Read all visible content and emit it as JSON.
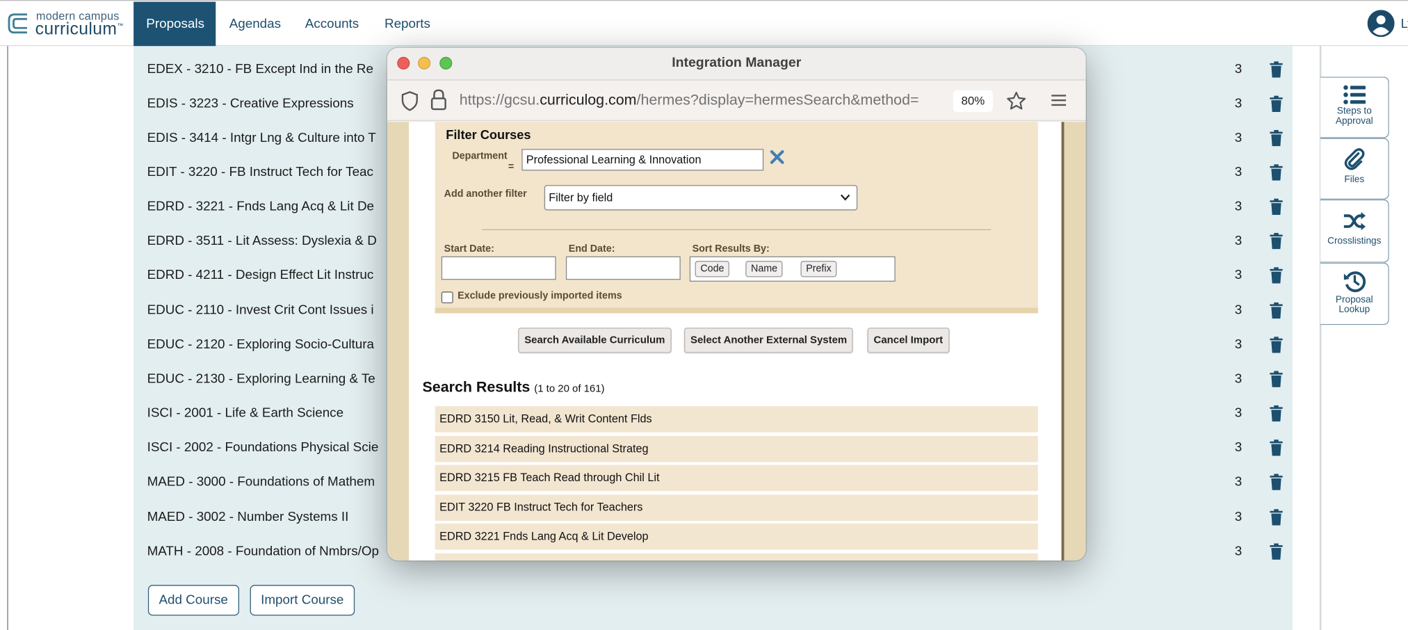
{
  "brand": {
    "small": "modern campus",
    "big": "curriculum",
    "tm": "™"
  },
  "nav": [
    "Proposals",
    "Agendas",
    "Accounts",
    "Reports"
  ],
  "user": {
    "initials": "Ly"
  },
  "courses": [
    {
      "title": "EDEX - 3210 - FB Except Ind in the Re",
      "credits": "3"
    },
    {
      "title": "EDIS - 3223 - Creative Expressions",
      "credits": "3"
    },
    {
      "title": "EDIS - 3414 - Intgr Lng & Culture into T",
      "credits": "3"
    },
    {
      "title": "EDIT - 3220 - FB Instruct Tech for Teac",
      "credits": "3"
    },
    {
      "title": "EDRD - 3221 - Fnds Lang Acq & Lit De",
      "credits": "3"
    },
    {
      "title": "EDRD - 3511 - Lit Assess: Dyslexia & D",
      "credits": "3"
    },
    {
      "title": "EDRD - 4211 - Design Effect Lit Instruc",
      "credits": "3"
    },
    {
      "title": "EDUC - 2110 - Invest Crit Cont Issues i",
      "credits": "3"
    },
    {
      "title": "EDUC - 2120 - Exploring Socio-Cultura",
      "credits": "3"
    },
    {
      "title": "EDUC - 2130 - Exploring Learning & Te",
      "credits": "3"
    },
    {
      "title": "ISCI - 2001 - Life & Earth Science",
      "credits": "3"
    },
    {
      "title": "ISCI - 2002 - Foundations Physical Scie",
      "credits": "3"
    },
    {
      "title": "MAED - 3000 - Foundations of Mathem",
      "credits": "3"
    },
    {
      "title": "MAED - 3002 - Number Systems II",
      "credits": "3"
    },
    {
      "title": "MATH - 2008 - Foundation of Nmbrs/Op",
      "credits": "3"
    }
  ],
  "buttons": {
    "add_course": "Add Course",
    "import_course": "Import Course"
  },
  "sidebar": [
    {
      "label": "Steps to Approval",
      "icon": "list-icon"
    },
    {
      "label": "Files",
      "icon": "paperclip-icon"
    },
    {
      "label": "Crosslistings",
      "icon": "shuffle-icon"
    },
    {
      "label": "Proposal Lookup",
      "icon": "history-icon"
    }
  ],
  "modal": {
    "title": "Integration Manager",
    "url_prefix": "https://gcsu.",
    "url_domain": "curriculog.com",
    "url_path": "/hermes?display=hermesSearch&method=",
    "zoom": "80%",
    "filter": {
      "heading": "Filter Courses",
      "department_label": "Department",
      "department_op": "=",
      "department_value": "Professional Learning & Innovation",
      "add_filter_label": "Add another filter",
      "add_filter_value": "Filter by field",
      "start_date_label": "Start Date:",
      "end_date_label": "End Date:",
      "sort_label": "Sort Results By:",
      "sort_chips": [
        "Code",
        "Name",
        "Prefix"
      ],
      "exclude_label": "Exclude previously imported items"
    },
    "actions": [
      "Search Available Curriculum",
      "Select Another External System",
      "Cancel Import"
    ],
    "results": {
      "title": "Search Results",
      "range": "(1 to 20 of 161)",
      "items": [
        "EDRD 3150 Lit, Read, & Writ Content Flds",
        "EDRD 3214 Reading Instructional Strateg",
        "EDRD 3215 FB Teach Read through Chil Lit",
        "EDIT 3220 FB Instruct Tech for Teachers",
        "EDRD 3221 Fnds Lang Acq & Lit Develop"
      ]
    }
  },
  "colors": {
    "navy": "#1d5273",
    "panel": "#e3eef0",
    "close": "#ec5f5a",
    "minimize": "#f4bf4f",
    "zoom": "#5fc454"
  }
}
